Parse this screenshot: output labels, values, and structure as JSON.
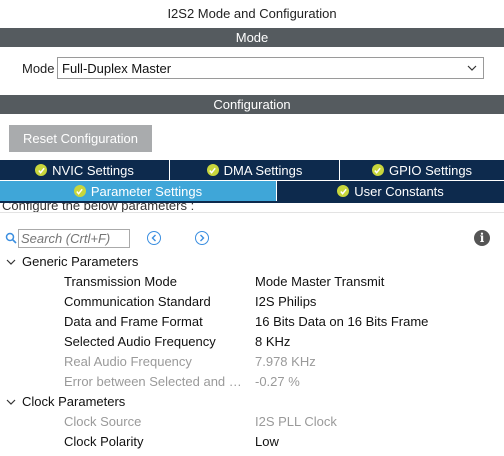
{
  "window": {
    "title": "I2S2 Mode and Configuration"
  },
  "mode_section": {
    "header": "Mode",
    "label": "Mode",
    "selected": "Full-Duplex Master"
  },
  "config_section": {
    "header": "Configuration",
    "reset_label": "Reset Configuration"
  },
  "tabs_row1": [
    {
      "label": "NVIC Settings",
      "icon": "check-circle-icon"
    },
    {
      "label": "DMA Settings",
      "icon": "check-circle-icon"
    },
    {
      "label": "GPIO Settings",
      "icon": "check-circle-icon"
    }
  ],
  "tabs_row2": [
    {
      "label": "Parameter Settings",
      "icon": "check-circle-icon",
      "active": true
    },
    {
      "label": "User Constants",
      "icon": "check-circle-icon",
      "active": false
    }
  ],
  "hint": "Configure the below parameters :",
  "search": {
    "placeholder": "Search (Crtl+F)"
  },
  "groups": [
    {
      "title": "Generic Parameters",
      "params": [
        {
          "name": "Transmission Mode",
          "value": "Mode Master Transmit",
          "enabled": true
        },
        {
          "name": "Communication Standard",
          "value": "I2S Philips",
          "enabled": true
        },
        {
          "name": "Data and Frame Format",
          "value": "16 Bits Data on 16 Bits Frame",
          "enabled": true
        },
        {
          "name": "Selected Audio Frequency",
          "value": "8 KHz",
          "enabled": true
        },
        {
          "name": "Real Audio Frequency",
          "value": "7.978 KHz",
          "enabled": false
        },
        {
          "name": "Error between Selected and Real",
          "value": "-0.27 %",
          "enabled": false
        }
      ]
    },
    {
      "title": "Clock Parameters",
      "params": [
        {
          "name": "Clock Source",
          "value": "I2S PLL Clock",
          "enabled": false
        },
        {
          "name": "Clock Polarity",
          "value": "Low",
          "enabled": true
        }
      ]
    }
  ],
  "colors": {
    "section_bar": "#555b5f",
    "tab_dark": "#0d2a4d",
    "tab_active": "#3fa6d8",
    "check_green": "#c8d63c",
    "disabled_text": "#9a9a9a"
  }
}
